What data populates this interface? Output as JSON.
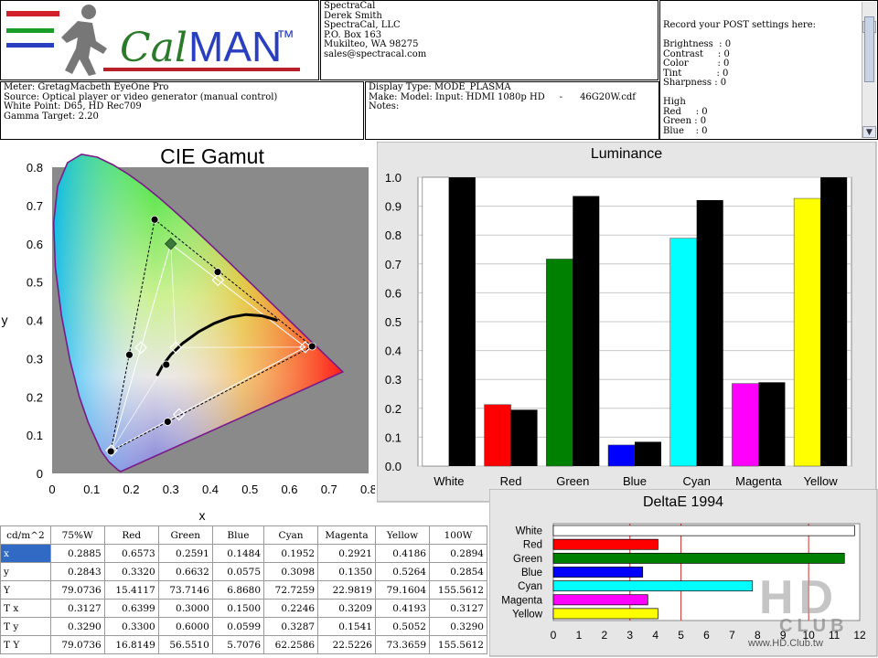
{
  "logo": {
    "text_cal": "Cal",
    "text_man": "MAN",
    "tm": "™"
  },
  "company": {
    "lines": [
      "SpectraCal",
      "Derek Smith",
      "SpectraCal, LLC",
      "P.O. Box 163",
      "Mukilteo, WA 98275",
      "sales@spectracal.com"
    ]
  },
  "post_settings": {
    "lines": [
      "Record your POST settings here:",
      "",
      "Brightness  : 0",
      "Contrast     : 0",
      "Color          : 0",
      "Tint            : 0",
      "Sharpness : 0",
      "",
      "High",
      "Red     : 0",
      "Green : 0",
      "Blue    : 0"
    ]
  },
  "meter_info": {
    "lines": [
      "Meter: GretagMacbeth EyeOne Pro",
      "Source: Optical player or video generator (manual control)",
      "White Point: D65, HD Rec709",
      "Gamma Target: 2.20"
    ]
  },
  "display_info": {
    "lines": [
      "Display Type: MODE_PLASMA",
      "Make: Model: Input: HDMI 1080p HD     -      46G20W.cdf",
      "Notes:"
    ]
  },
  "colors": {
    "white": "#ffffff",
    "red": "#ff0000",
    "green": "#008000",
    "blue": "#0000ff",
    "cyan": "#00ffff",
    "magenta": "#ff00ff",
    "yellow": "#ffff00",
    "black": "#000000",
    "panel_bg": "#e6e6e6"
  },
  "watermark": {
    "big": "HD",
    "small": "CLUB",
    "url": "www.HD.Club.tw"
  },
  "chart_data": [
    {
      "type": "scatter",
      "title": "CIE Gamut",
      "xlabel": "x",
      "ylabel": "y",
      "xlim": [
        0,
        0.8
      ],
      "ylim": [
        0,
        0.8
      ],
      "xticks": [
        "0",
        "0.1",
        "0.2",
        "0.3",
        "0.4",
        "0.5",
        "0.6",
        "0.7",
        "0.8"
      ],
      "yticks": [
        "0",
        "0.1",
        "0.2",
        "0.3",
        "0.4",
        "0.5",
        "0.6",
        "0.7",
        "0.8"
      ],
      "target_points": [
        {
          "name": "White",
          "x": 0.3127,
          "y": 0.329
        },
        {
          "name": "Red",
          "x": 0.64,
          "y": 0.33
        },
        {
          "name": "Green",
          "x": 0.3,
          "y": 0.6
        },
        {
          "name": "Blue",
          "x": 0.15,
          "y": 0.06
        },
        {
          "name": "Cyan",
          "x": 0.2246,
          "y": 0.3287
        },
        {
          "name": "Magenta",
          "x": 0.3209,
          "y": 0.1541
        },
        {
          "name": "Yellow",
          "x": 0.4193,
          "y": 0.5052
        }
      ],
      "measured_points": [
        {
          "name": "White",
          "x": 0.2885,
          "y": 0.2843
        },
        {
          "name": "Red",
          "x": 0.6573,
          "y": 0.332
        },
        {
          "name": "Green",
          "x": 0.2591,
          "y": 0.6632
        },
        {
          "name": "Blue",
          "x": 0.1484,
          "y": 0.0575
        },
        {
          "name": "Cyan",
          "x": 0.1952,
          "y": 0.3098
        },
        {
          "name": "Magenta",
          "x": 0.2921,
          "y": 0.135
        },
        {
          "name": "Yellow",
          "x": 0.4186,
          "y": 0.5264
        }
      ],
      "blackbody_curve": [
        [
          0.265,
          0.255
        ],
        [
          0.28,
          0.283
        ],
        [
          0.3,
          0.31
        ],
        [
          0.33,
          0.34
        ],
        [
          0.37,
          0.37
        ],
        [
          0.41,
          0.392
        ],
        [
          0.45,
          0.408
        ],
        [
          0.49,
          0.415
        ],
        [
          0.53,
          0.412
        ],
        [
          0.57,
          0.4
        ]
      ]
    },
    {
      "type": "bar",
      "title": "Luminance",
      "categories": [
        "White",
        "Red",
        "Green",
        "Blue",
        "Cyan",
        "Magenta",
        "Yellow"
      ],
      "series": [
        {
          "values": [
            1.0,
            0.213,
            0.717,
            0.073,
            0.789,
            0.286,
            0.927
          ]
        },
        {
          "values": [
            1.0,
            0.195,
            0.935,
            0.084,
            0.921,
            0.29,
            1.0
          ]
        }
      ],
      "ylim": [
        0,
        1.0
      ],
      "yticks": [
        "0.0",
        "0.1",
        "0.2",
        "0.3",
        "0.4",
        "0.5",
        "0.6",
        "0.7",
        "0.8",
        "0.9",
        "1.0"
      ]
    },
    {
      "type": "bar",
      "title": "DeltaE 1994",
      "orientation": "horizontal",
      "categories": [
        "White",
        "Red",
        "Green",
        "Blue",
        "Cyan",
        "Magenta",
        "Yellow"
      ],
      "values": [
        11.8,
        4.1,
        11.4,
        3.5,
        7.8,
        3.7,
        4.1
      ],
      "xlim": [
        0,
        12
      ],
      "xticks": [
        "0",
        "1",
        "2",
        "3",
        "4",
        "5",
        "6",
        "7",
        "8",
        "9",
        "10",
        "11",
        "12"
      ],
      "reference_lines": [
        3,
        5,
        10
      ]
    },
    {
      "type": "table",
      "header": [
        "cd/m^2",
        "75%W",
        "Red",
        "Green",
        "Blue",
        "Cyan",
        "Magenta",
        "Yellow",
        "100W"
      ],
      "rows": [
        [
          "x",
          "0.2885",
          "0.6573",
          "0.2591",
          "0.1484",
          "0.1952",
          "0.2921",
          "0.4186",
          "0.2894"
        ],
        [
          "y",
          "0.2843",
          "0.3320",
          "0.6632",
          "0.0575",
          "0.3098",
          "0.1350",
          "0.5264",
          "0.2854"
        ],
        [
          "Y",
          "79.0736",
          "15.4117",
          "73.7146",
          "6.8680",
          "72.7259",
          "22.9819",
          "79.1604",
          "155.5612"
        ],
        [
          "T x",
          "0.3127",
          "0.6399",
          "0.3000",
          "0.1500",
          "0.2246",
          "0.3209",
          "0.4193",
          "0.3127"
        ],
        [
          "T y",
          "0.3290",
          "0.3300",
          "0.6000",
          "0.0599",
          "0.3287",
          "0.1541",
          "0.5052",
          "0.3290"
        ],
        [
          "T Y",
          "79.0736",
          "16.8149",
          "56.5510",
          "5.7076",
          "62.2586",
          "22.5226",
          "73.3659",
          "155.5612"
        ]
      ]
    }
  ]
}
